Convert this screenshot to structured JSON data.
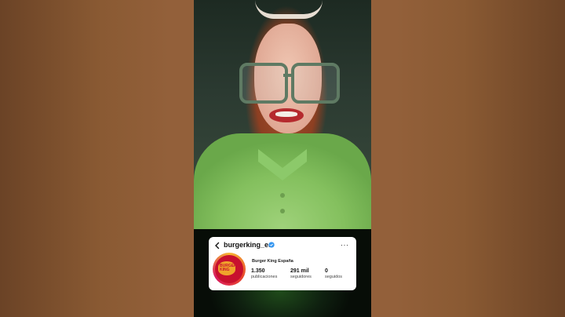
{
  "profile": {
    "username": "burgerking_es",
    "display_name": "Burger King España",
    "avatar_text": "BURGER KING",
    "stats": [
      {
        "value": "1.350",
        "label": "publicaciones"
      },
      {
        "value": "291 mil",
        "label": "seguidores"
      },
      {
        "value": "0",
        "label": "seguidos"
      }
    ]
  },
  "icons": {
    "back": "chevron-left-icon",
    "verified": "verified-badge-icon",
    "more": "more-options-icon",
    "more_glyph": "···"
  },
  "colors": {
    "background": "#8a5a33",
    "verified": "#3797f0",
    "avatar_red": "#c8102e"
  }
}
